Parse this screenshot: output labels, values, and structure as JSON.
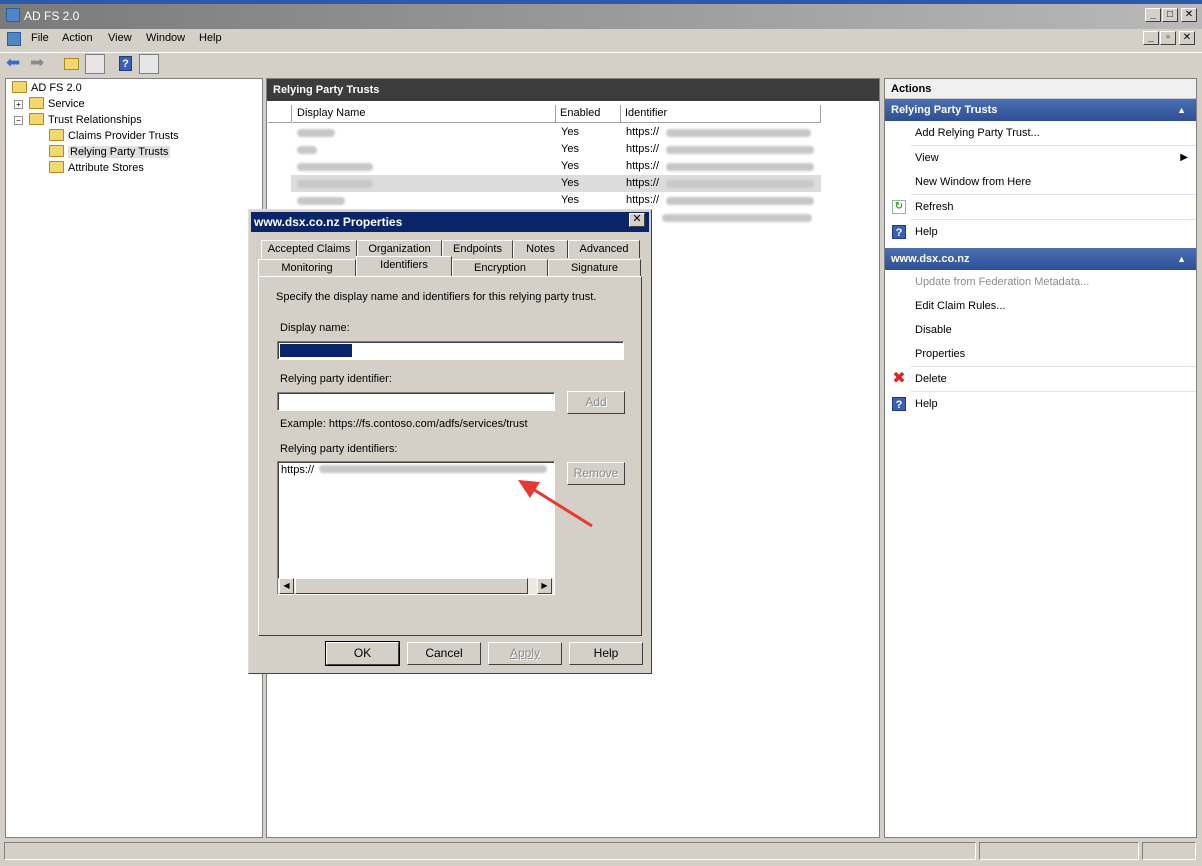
{
  "window": {
    "title": "AD FS 2.0"
  },
  "menu": [
    "File",
    "Action",
    "View",
    "Window",
    "Help"
  ],
  "tree": {
    "root": "AD FS 2.0",
    "items": [
      {
        "label": "Service",
        "expander": "+"
      },
      {
        "label": "Trust Relationships",
        "expander": "−"
      },
      {
        "label": "Claims Provider Trusts"
      },
      {
        "label": "Relying Party Trusts",
        "selected": true
      },
      {
        "label": "Attribute Stores"
      }
    ]
  },
  "center": {
    "title": "Relying Party Trusts",
    "columns": [
      "Display Name",
      "Enabled",
      "Identifier"
    ],
    "rows": [
      {
        "enabled": "Yes",
        "identifier_prefix": "https://"
      },
      {
        "enabled": "Yes",
        "identifier_prefix": "https://"
      },
      {
        "enabled": "Yes",
        "identifier_prefix": "https://"
      },
      {
        "enabled": "Yes",
        "identifier_prefix": "https://",
        "selected": true
      },
      {
        "enabled": "Yes",
        "identifier_prefix": "https://"
      }
    ]
  },
  "actions": {
    "header": "Actions",
    "section1": {
      "title": "Relying Party Trusts",
      "items": [
        "Add Relying Party Trust...",
        "View",
        "New Window from Here",
        "Refresh",
        "Help"
      ]
    },
    "section2": {
      "title": "www.dsx.co.nz",
      "items": [
        "Update from Federation Metadata...",
        "Edit Claim Rules...",
        "Disable",
        "Properties",
        "Delete",
        "Help"
      ]
    }
  },
  "dialog": {
    "title": "www.dsx.co.nz Properties",
    "tabs_row1": [
      "Accepted Claims",
      "Organization",
      "Endpoints",
      "Notes",
      "Advanced"
    ],
    "tabs_row2": [
      "Monitoring",
      "Identifiers",
      "Encryption",
      "Signature"
    ],
    "active_tab": "Identifiers",
    "description": "Specify the display name and identifiers for this relying party trust.",
    "display_name_label": "Display name:",
    "rp_identifier_label": "Relying party identifier:",
    "add_label": "Add",
    "example": "Example: https://fs.contoso.com/adfs/services/trust",
    "rp_identifiers_label": "Relying party identifiers:",
    "identifier_prefix": "https://",
    "remove_label": "Remove",
    "buttons": {
      "ok": "OK",
      "cancel": "Cancel",
      "apply": "Apply",
      "help": "Help"
    }
  },
  "colors": {
    "accent": "#2e4f93",
    "dialog_title": "#0a246a",
    "arrow": "#e8382f"
  }
}
